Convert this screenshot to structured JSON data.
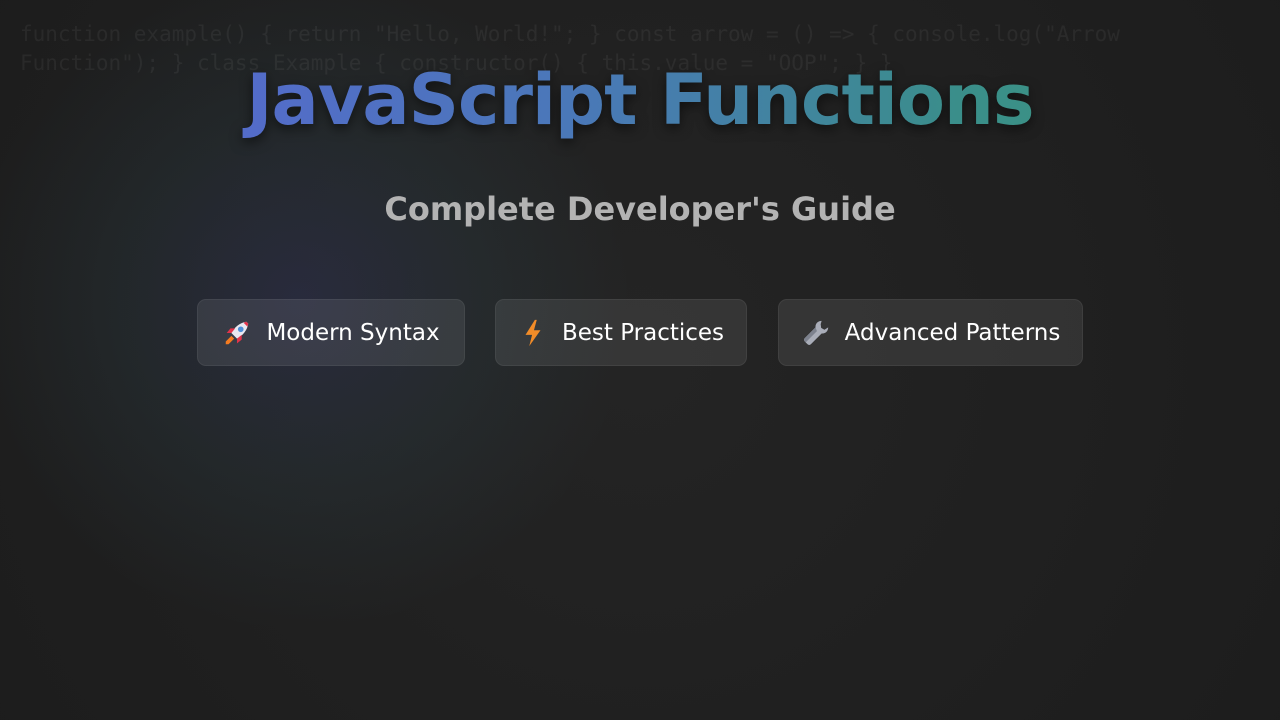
{
  "background_code": "function example() { return \"Hello, World!\"; } const arrow = () => { console.log(\"Arrow Function\"); } class Example { constructor() { this.value = \"OOP\"; } }",
  "hero": {
    "title": "JavaScript Functions",
    "subtitle": "Complete Developer's Guide"
  },
  "features": [
    {
      "label": "Modern Syntax",
      "icon": "rocket-icon"
    },
    {
      "label": "Best Practices",
      "icon": "lightning-icon"
    },
    {
      "label": "Advanced Patterns",
      "icon": "wrench-icon"
    }
  ],
  "colors": {
    "background": "#1f1f1f",
    "title_gradient_start": "#5a63d6",
    "title_gradient_end": "#3e9a7a",
    "subtitle": "#b3b3b3",
    "pill_text": "#ffffff"
  }
}
